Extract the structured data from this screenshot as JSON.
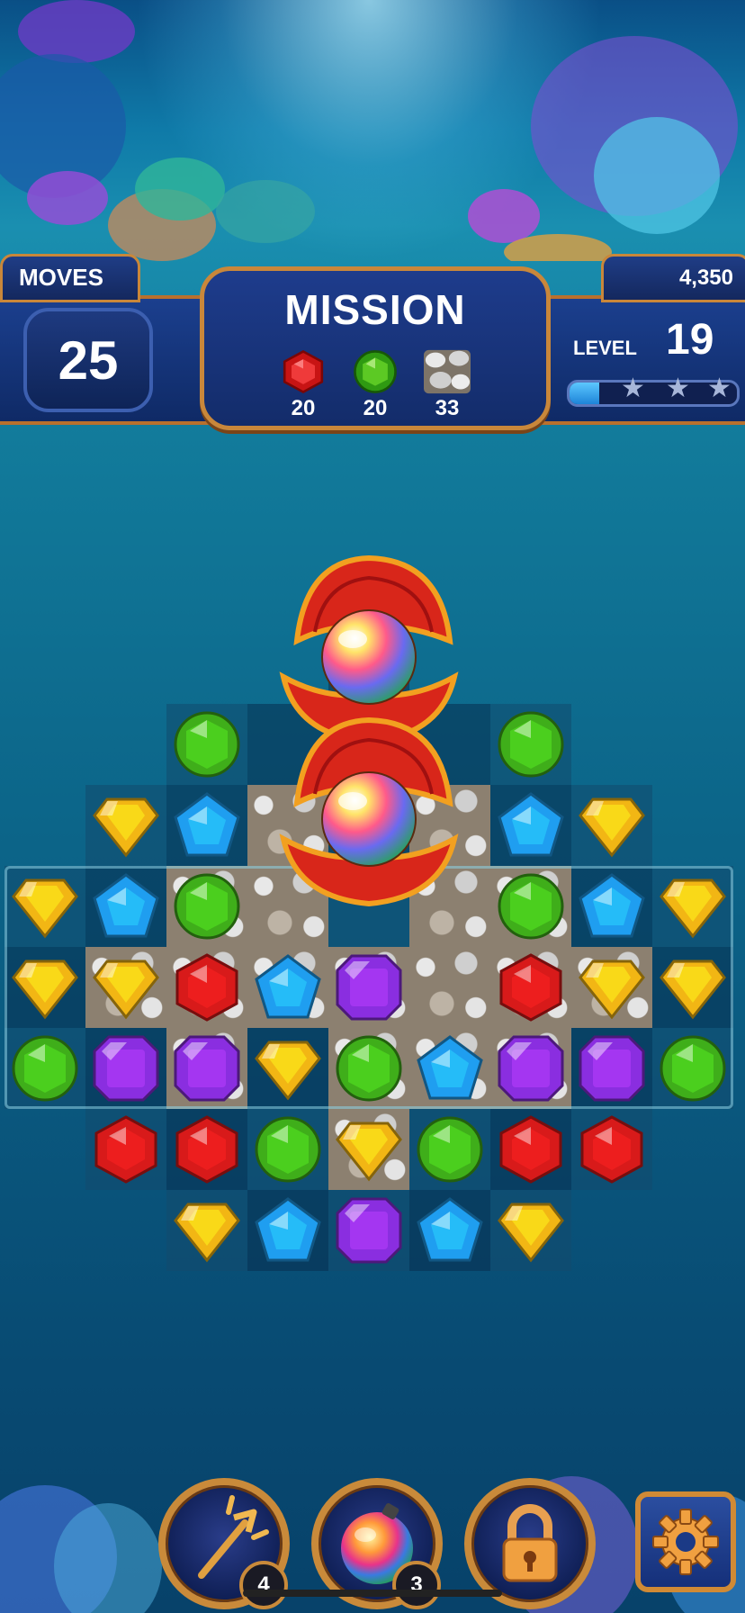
{
  "hud": {
    "moves_label": "MOVES",
    "moves_value": "25",
    "mission_title": "MISSION",
    "score": "4,350",
    "level_label": "LEVEL",
    "level_value": "19",
    "level_progress_fraction": 0.18,
    "stars_total": 3,
    "goals": [
      {
        "icon": "red-gem-icon",
        "count": "20"
      },
      {
        "icon": "green-gem-icon",
        "count": "20"
      },
      {
        "icon": "stone-tile-icon",
        "count": "33"
      }
    ]
  },
  "colors": {
    "red": "#d81a1a",
    "green": "#3fae1a",
    "blue": "#1f9ef0",
    "yellow": "#f2b614",
    "purple": "#8a2ee0",
    "frame_gold": "#c9873a",
    "hud_navy": "#14285e"
  },
  "board": {
    "cols": 9,
    "rows": 8,
    "layout": [
      "....#....",
      "..#####..",
      ".#######.",
      "#########",
      "#########",
      "#########",
      ".#######.",
      "..#####.."
    ],
    "gems": [
      ".........",
      "..G.Y.G..",
      ".YB...BY.",
      "YBG...GBY",
      "YYRBP.RYY",
      "GPPYGBPPG",
      ".RRGYGRR.",
      "..YBPBY.."
    ],
    "stones": [
      ".........",
      ".........",
      "...S.S...",
      "..SS.SS..",
      ".SSSSSSS.",
      "..S.SSS..",
      "....S....",
      "........."
    ],
    "specials": [
      {
        "type": "rainbow-pearl-shell",
        "col": 4,
        "row": 0
      },
      {
        "type": "rainbow-pearl-shell",
        "col": 4,
        "row": 2
      }
    ]
  },
  "boosters": [
    {
      "name": "trident-booster",
      "icon": "trident-icon",
      "count": "4"
    },
    {
      "name": "rainbow-bomb-booster",
      "icon": "rainbow-bomb-icon",
      "count": "3"
    },
    {
      "name": "locked-booster",
      "icon": "lock-icon",
      "count": ""
    }
  ],
  "settings": {
    "icon": "gear-icon"
  }
}
